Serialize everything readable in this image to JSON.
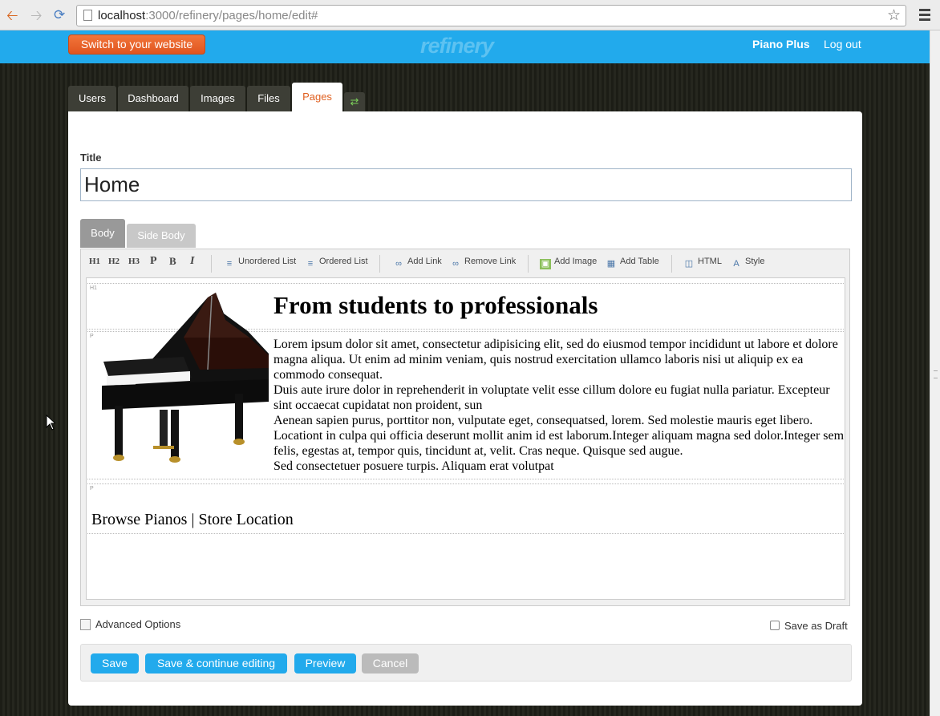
{
  "browser": {
    "url_host": "localhost",
    "url_path": ":3000/refinery/pages/home/edit#"
  },
  "header": {
    "switch_label": "Switch to your website",
    "brand": "refinery",
    "user": "Piano Plus",
    "logout": "Log out"
  },
  "tabs": [
    {
      "label": "Users"
    },
    {
      "label": "Dashboard"
    },
    {
      "label": "Images"
    },
    {
      "label": "Files"
    },
    {
      "label": "Pages"
    }
  ],
  "active_tab": "Pages",
  "form": {
    "title_label": "Title",
    "title_value": "Home",
    "body_tabs": [
      "Body",
      "Side Body"
    ]
  },
  "toolbar": {
    "h1": "H1",
    "h2": "H2",
    "h3": "H3",
    "p": "P",
    "b": "B",
    "i": "I",
    "unordered_list": "Unordered List",
    "ordered_list": "Ordered List",
    "add_link": "Add Link",
    "remove_link": "Remove Link",
    "add_image": "Add Image",
    "add_table": "Add Table",
    "html": "HTML",
    "style": "Style"
  },
  "content": {
    "block_tags": [
      "H1",
      "P",
      "P"
    ],
    "heading": "From students to professionals",
    "paragraphs": [
      "Lorem ipsum dolor sit amet, consectetur adipisicing elit, sed do eiusmod tempor incididunt ut labore et dolore magna aliqua. Ut enim ad minim veniam, quis nostrud exercitation ullamco laboris nisi ut aliquip ex ea commodo consequat.",
      "Duis aute irure dolor in reprehenderit in voluptate velit esse cillum dolore eu fugiat nulla pariatur. Excepteur sint occaecat cupidatat non proident, sun",
      "Aenean sapien purus, porttitor non, vulputate eget, consequatsed, lorem. Sed molestie mauris eget libero. Locationt in culpa qui officia deserunt mollit anim id est laborum.Integer aliquam magna sed dolor.Integer sem felis, egestas at, tempor quis, tincidunt at, velit. Cras neque. Quisque sed augue.",
      "Sed consectetuer posuere turpis. Aliquam erat volutpat"
    ],
    "links_line": "Browse Pianos | Store Location"
  },
  "options": {
    "advanced": "Advanced Options",
    "save_as_draft": "Save as Draft"
  },
  "actions": {
    "save": "Save",
    "save_continue": "Save & continue editing",
    "preview": "Preview",
    "cancel": "Cancel"
  },
  "colors": {
    "header_blue": "#22aaec",
    "switch_orange": "#e0551f",
    "active_tab_text": "#e06020"
  }
}
